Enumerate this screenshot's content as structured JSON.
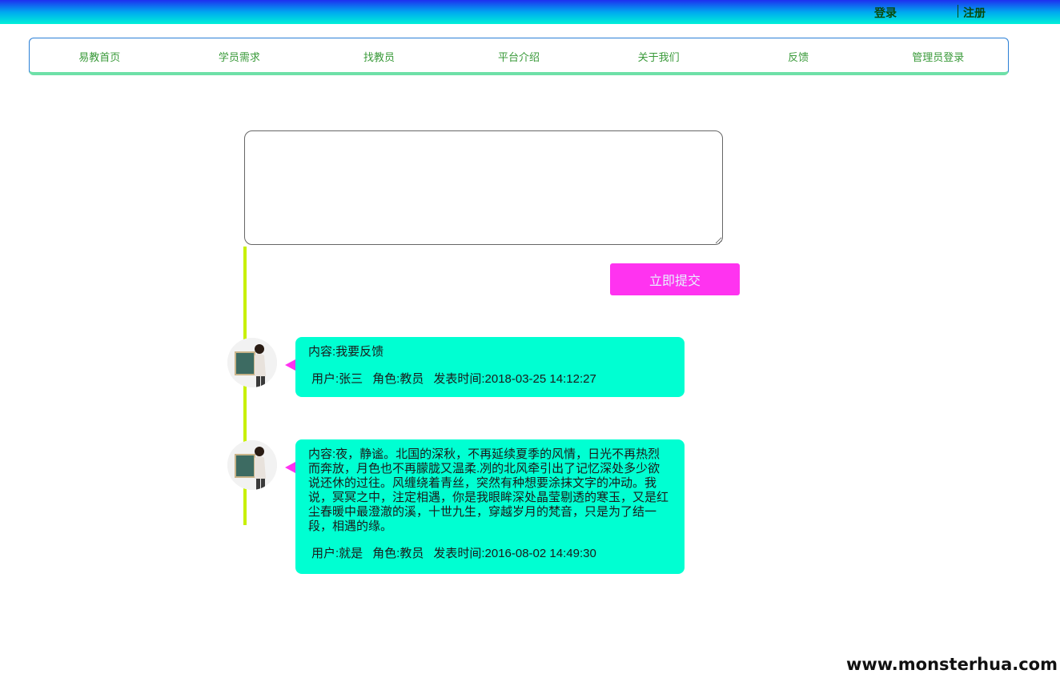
{
  "topbar": {
    "login_label": "登录",
    "register_label": "注册"
  },
  "nav": {
    "items": [
      {
        "label": "易教首页"
      },
      {
        "label": "学员需求"
      },
      {
        "label": "找教员"
      },
      {
        "label": "平台介绍"
      },
      {
        "label": "关于我们"
      },
      {
        "label": "反馈"
      },
      {
        "label": "管理员登录"
      }
    ]
  },
  "form": {
    "textarea_value": "",
    "submit_label": "立即提交"
  },
  "entries": [
    {
      "content": "内容:我要反馈",
      "user": "用户:张三",
      "role": "角色:教员",
      "time": "发表时间:2018-03-25 14:12:27"
    },
    {
      "content": "内容:夜，静谧。北国的深秋，不再延续夏季的风情，日光不再热烈而奔放，月色也不再朦胧又温柔.冽的北风牵引出了记忆深处多少欲说还休的过往。风缠绕着青丝，突然有种想要涂抹文字的冲动。我说，冥冥之中，注定相遇，你是我眼眸深处晶莹剔透的寒玉，又是红尘春暖中最澄澈的溪，十世九生，穿越岁月的梵音，只是为了结一段，相遇的缘。",
      "user": "用户:就是",
      "role": "角色:教员",
      "time": "发表时间:2016-08-02 14:49:30"
    }
  ],
  "watermark": "www.monsterhua.com",
  "colors": {
    "accent_submit": "#ff33f0",
    "bubble": "#00ffd2",
    "timeline": "#c8f000",
    "nav_text": "#3a9a3a"
  },
  "icons": {
    "avatar": "teacher-avatar-icon"
  }
}
